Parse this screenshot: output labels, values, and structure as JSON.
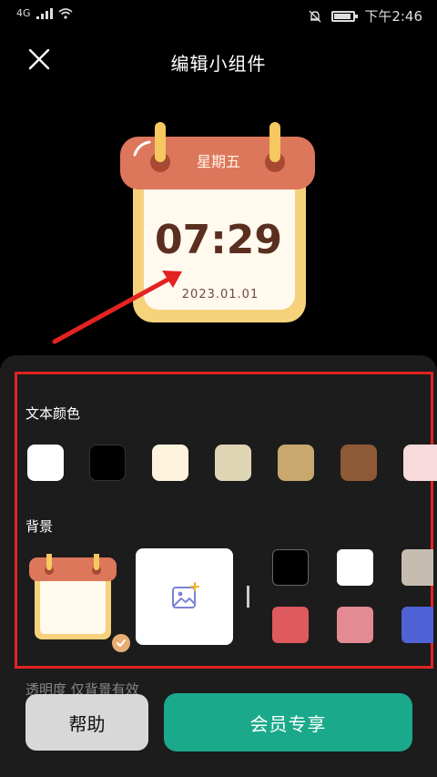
{
  "status": {
    "network": "4G",
    "time": "下午2:46",
    "battery_level": 0.82
  },
  "header": {
    "title": "编辑小组件"
  },
  "widget": {
    "weekday": "星期五",
    "time": "07:29",
    "date": "2023.01.01"
  },
  "text_color": {
    "label": "文本颜色",
    "swatches": [
      "#ffffff",
      "#000000",
      "#fdf3dc",
      "#ddd5b4",
      "#c8a86e",
      "#8e5a36",
      "#f8d9dc"
    ]
  },
  "background": {
    "label": "背景",
    "swatches": [
      "#000000",
      "#ffffff",
      "#c6bdb0",
      "#de5a5f",
      "#e38a92",
      "#4f63d6"
    ]
  },
  "opacity": {
    "label": "透明度  仅背景有效"
  },
  "buttons": {
    "help": "帮助",
    "vip": "会员专享"
  }
}
